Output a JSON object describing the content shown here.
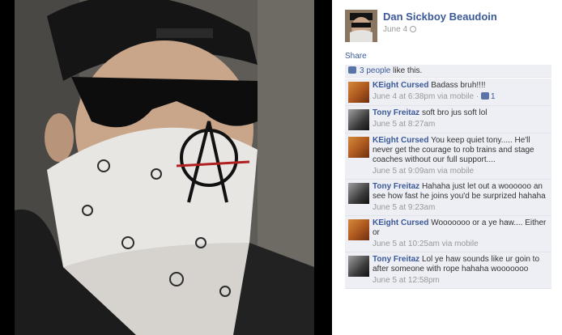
{
  "post": {
    "owner_name": "Dan Sickboy Beaudoin",
    "date": "June 4",
    "share_label": "Share"
  },
  "likes": {
    "count_text": "3 people",
    "suffix": " like this."
  },
  "comments": [
    {
      "author": "KEight Cursed",
      "text": "Badass bruh!!!!",
      "time": "June 4 at 6:38pm via mobile",
      "likes": "1",
      "avatar": "k"
    },
    {
      "author": "Tony Freitaz",
      "text": "soft bro jus soft lol",
      "time": "June 5 at 8:27am",
      "avatar": "t"
    },
    {
      "author": "KEight Cursed",
      "text": "You keep quiet tony..... He'll never get the courage to rob trains and stage coaches without our full support....",
      "time": "June 5 at 9:09am via mobile",
      "avatar": "k"
    },
    {
      "author": "Tony Freitaz",
      "text": "Hahaha just let out a woooooo an see how fast he joins you'd be surprized hahaha",
      "time": "June 5 at 9:23am",
      "avatar": "t"
    },
    {
      "author": "KEight Cursed",
      "text": "Wooooooo or a ye haw.... Either or",
      "time": "June 5 at 10:25am via mobile",
      "avatar": "k"
    },
    {
      "author": "Tony Freitaz",
      "text": "Lol ye haw sounds like ur goin to after someone with rope hahaha wooooooo",
      "time": "June 5 at 12:58pm",
      "avatar": "t"
    }
  ],
  "colors": {
    "link": "#3b5998",
    "comment_bg": "#edeff4",
    "meta": "#999999"
  }
}
